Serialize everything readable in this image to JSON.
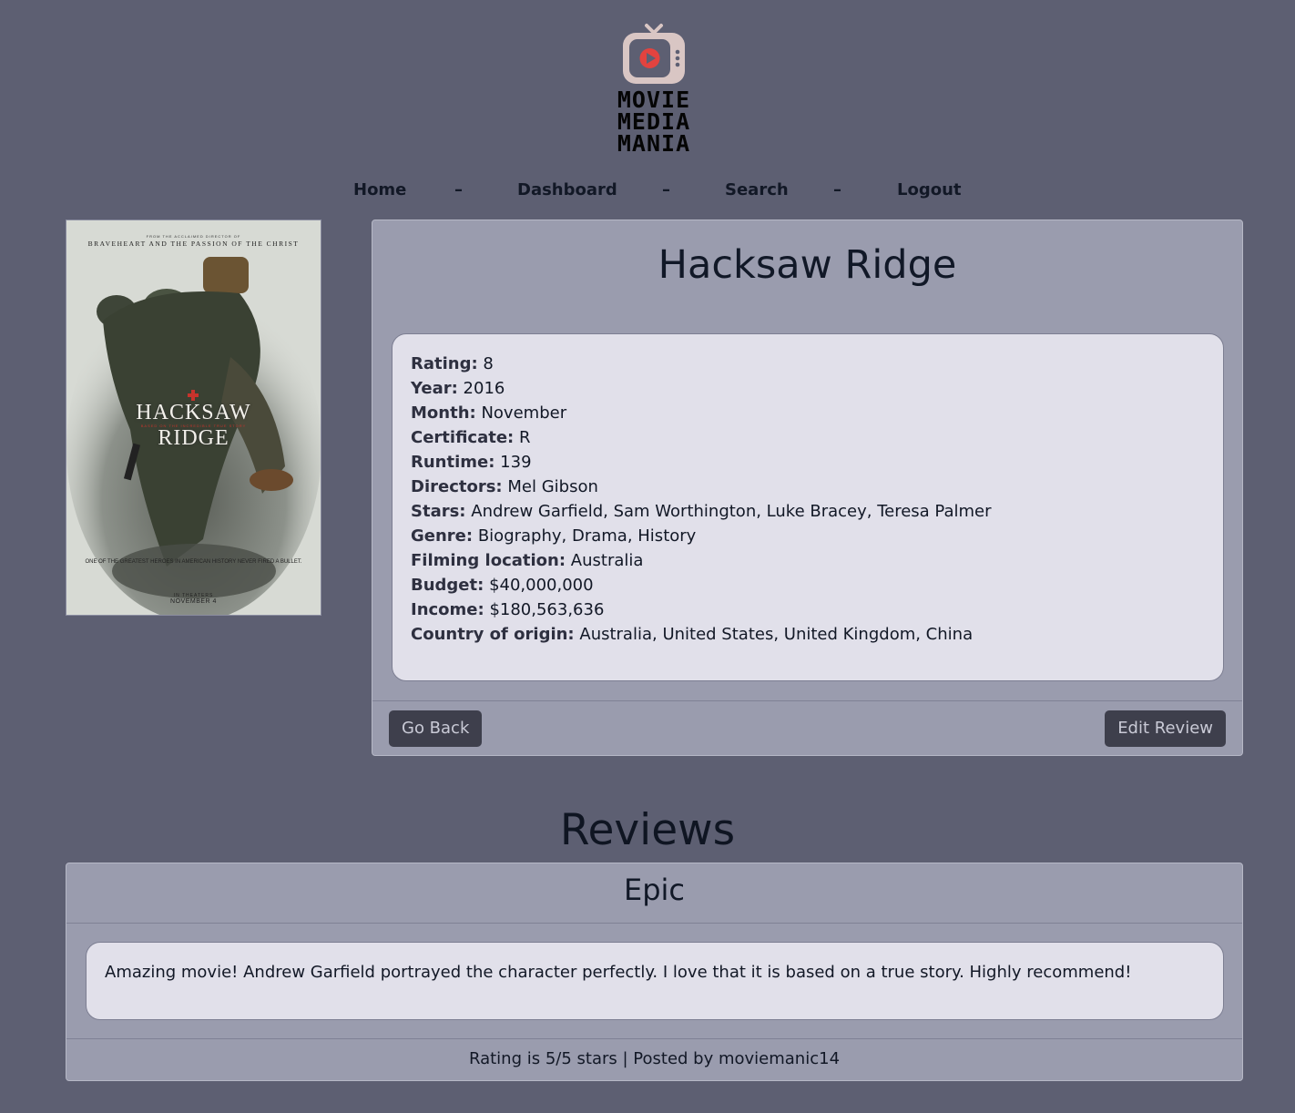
{
  "brand": {
    "logo_icon": "tv-play-icon",
    "line1": "MOVIE",
    "line2": "MEDIA",
    "line3": "MANIA"
  },
  "nav": {
    "home": "Home",
    "dashboard": "Dashboard",
    "search": "Search",
    "logout": "Logout",
    "separator": "–"
  },
  "poster": {
    "tagline": "FROM THE ACCLAIMED DIRECTOR OF",
    "credits_line": "BRAVEHEART AND THE PASSION OF THE CHRIST",
    "title_line1": "HACKSAW",
    "title_line2": "RIDGE",
    "subtitle": "BASED ON THE INCREDIBLE TRUE STORY",
    "bottom_tagline": "ONE OF THE GREATEST HEROES IN AMERICAN HISTORY NEVER FIRED A BULLET.",
    "release1": "IN THEATERS",
    "release2": "NOVEMBER 4"
  },
  "movie": {
    "title": "Hacksaw Ridge",
    "fields": [
      {
        "label": "Rating:",
        "value": "8"
      },
      {
        "label": "Year:",
        "value": "2016"
      },
      {
        "label": "Month:",
        "value": "November"
      },
      {
        "label": "Certificate:",
        "value": "R"
      },
      {
        "label": "Runtime:",
        "value": "139"
      },
      {
        "label": "Directors:",
        "value": "Mel Gibson"
      },
      {
        "label": "Stars:",
        "value": "Andrew Garfield, Sam Worthington, Luke Bracey, Teresa Palmer"
      },
      {
        "label": "Genre:",
        "value": "Biography, Drama, History"
      },
      {
        "label": "Filming location:",
        "value": "Australia"
      },
      {
        "label": "Budget:",
        "value": "$40,000,000"
      },
      {
        "label": "Income:",
        "value": "$180,563,636"
      },
      {
        "label": "Country of origin:",
        "value": "Australia, United States, United Kingdom, China"
      }
    ],
    "go_back_label": "Go Back",
    "edit_review_label": "Edit Review"
  },
  "reviews": {
    "heading": "Reviews",
    "items": [
      {
        "title": "Epic",
        "body": "Amazing movie! Andrew Garfield portrayed the character perfectly. I love that it is based on a true story. Highly recommend!",
        "footer": "Rating is 5/5 stars | Posted by moviemanic14"
      }
    ]
  },
  "colors": {
    "page_bg": "#5d5f72",
    "card_bg": "#9a9cae",
    "panel_bg": "#e1e0ea",
    "button_bg": "#3e3f4c",
    "play_red": "#e2433f"
  }
}
